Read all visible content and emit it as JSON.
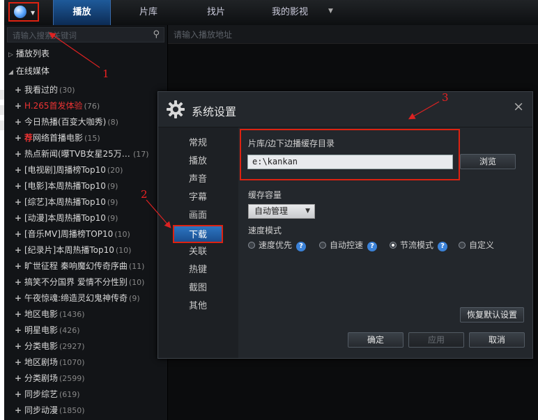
{
  "topbar": {
    "tabs": [
      {
        "label": "播放",
        "active": true
      },
      {
        "label": "片库"
      },
      {
        "label": "找片"
      },
      {
        "label": "我的影视"
      }
    ]
  },
  "sidebar": {
    "search_placeholder": "请输入搜索关键词",
    "playlist_label": "播放列表",
    "online_label": "在线媒体",
    "items": [
      {
        "text": "我看过的",
        "count": "(30)"
      },
      {
        "text": "H.265首发体验",
        "count": "(76)",
        "red": true
      },
      {
        "text": "今日热播(百变大咖秀)",
        "count": "(8)"
      },
      {
        "badge": "荐",
        "text": "网络首播电影",
        "count": "(15)"
      },
      {
        "text": "热点新闻(曝TVB女星25万…",
        "count": "(17)"
      },
      {
        "text": "[电视剧]周播榜Top10",
        "count": "(20)"
      },
      {
        "text": "[电影]本周热播Top10",
        "count": "(9)"
      },
      {
        "text": "[综艺]本周热播Top10",
        "count": "(9)"
      },
      {
        "text": "[动漫]本周热播Top10",
        "count": "(9)"
      },
      {
        "text": "[音乐MV]周播榜TOP10",
        "count": "(10)"
      },
      {
        "text": "[纪录片]本周热播Top10",
        "count": "(10)"
      },
      {
        "text": "旷世征程 秦响魔幻传奇序曲",
        "count": "(11)"
      },
      {
        "text": "搞笑不分国界 爱情不分性别",
        "count": "(10)"
      },
      {
        "text": "午夜惊魂:缔造灵幻鬼神传奇",
        "count": "(9)"
      },
      {
        "text": "地区电影",
        "count": "(1436)"
      },
      {
        "text": "明星电影",
        "count": "(426)"
      },
      {
        "text": "分类电影",
        "count": "(2927)"
      },
      {
        "text": "地区剧场",
        "count": "(1070)"
      },
      {
        "text": "分类剧场",
        "count": "(2599)"
      },
      {
        "text": "同步综艺",
        "count": "(619)"
      },
      {
        "text": "同步动漫",
        "count": "(1850)"
      }
    ]
  },
  "main": {
    "url_placeholder": "请输入播放地址"
  },
  "annotations": [
    "1",
    "2",
    "3"
  ],
  "dialog": {
    "title": "系统设置",
    "close": "×",
    "nav": [
      "常规",
      "播放",
      "声音",
      "字幕",
      "画面",
      "下载",
      "关联",
      "热键",
      "截图",
      "其他"
    ],
    "active_nav": "下载",
    "cache_dir_label": "片库/边下边播缓存目录",
    "cache_dir_value": "e:\\kankan",
    "browse": "浏览",
    "capacity_label": "缓存容量",
    "capacity_value": "自动管理",
    "speed_label": "速度模式",
    "speed_options": [
      {
        "label": "速度优先",
        "help": true,
        "selected": false
      },
      {
        "label": "自动控速",
        "help": true,
        "selected": false
      },
      {
        "label": "节流模式",
        "help": true,
        "selected": true
      },
      {
        "label": "自定义",
        "help": false,
        "selected": false
      }
    ],
    "help_glyph": "?",
    "restore": "恢复默认设置",
    "ok": "确定",
    "apply": "应用",
    "cancel": "取消"
  },
  "colors": {
    "accent": "#1e5a9a",
    "annotation": "#dd2222",
    "item_red": "#e33333"
  }
}
